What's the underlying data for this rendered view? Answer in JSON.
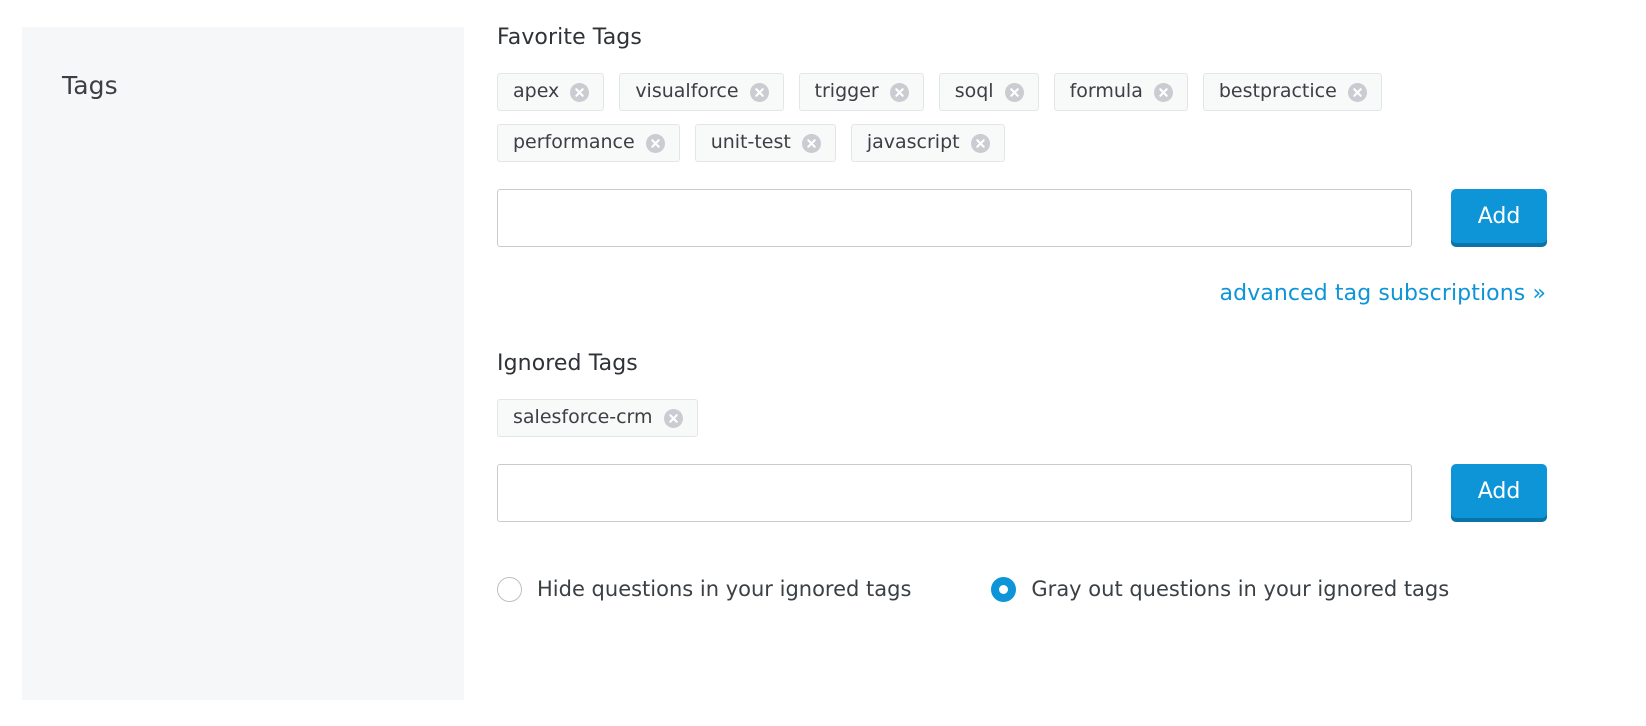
{
  "sidebar": {
    "title": "Tags"
  },
  "favorite": {
    "heading": "Favorite Tags",
    "tags": [
      "apex",
      "visualforce",
      "trigger",
      "soql",
      "formula",
      "bestpractice",
      "performance",
      "unit-test",
      "javascript"
    ],
    "input_value": "",
    "input_placeholder": "",
    "add_label": "Add",
    "remove_icon": "remove-circle-icon"
  },
  "advanced_link": {
    "label": "advanced tag subscriptions »"
  },
  "ignored": {
    "heading": "Ignored Tags",
    "tags": [
      "salesforce-crm"
    ],
    "input_value": "",
    "input_placeholder": "",
    "add_label": "Add",
    "remove_icon": "remove-circle-icon"
  },
  "ignored_behavior": {
    "options": [
      {
        "label": "Hide questions in your ignored tags",
        "selected": false
      },
      {
        "label": "Gray out questions in your ignored tags",
        "selected": true
      }
    ]
  },
  "colors": {
    "accent": "#0d95d8",
    "link": "#0d95d8",
    "sidebar_bg": "#f6f7f8",
    "chip_bg": "#f8f9f9",
    "chip_border": "#e3e6e8",
    "text": "#3b4045",
    "input_border": "#c8ccd0",
    "chip_icon": "#c9cdd1"
  }
}
